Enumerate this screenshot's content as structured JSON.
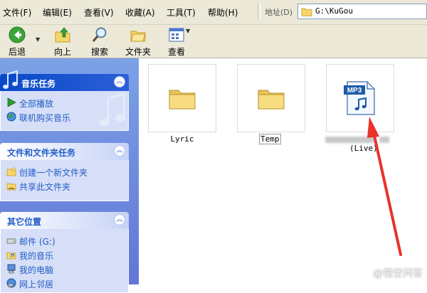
{
  "menubar": {
    "items": [
      "文件(F)",
      "编辑(E)",
      "查看(V)",
      "收藏(A)",
      "工具(T)",
      "帮助(H)"
    ],
    "address_label": "地址(D)",
    "address_value": "G:\\KuGou"
  },
  "toolbar": {
    "back": "后退",
    "up": "向上",
    "search": "搜索",
    "folders": "文件夹",
    "views": "查看"
  },
  "taskpane": {
    "music_tasks": {
      "title": "音乐任务",
      "items": [
        "全部播放",
        "联机购买音乐"
      ]
    },
    "file_tasks": {
      "title": "文件和文件夹任务",
      "items": [
        "创建一个新文件夹",
        "共享此文件夹"
      ]
    },
    "other_places": {
      "title": "其它位置",
      "items": [
        "邮件 (G:)",
        "我的音乐",
        "我的电脑",
        "网上邻居"
      ]
    }
  },
  "content": {
    "items": [
      {
        "name": "Lyric",
        "type": "folder"
      },
      {
        "name": "Temp",
        "type": "folder"
      },
      {
        "name_suffix": "(Live)",
        "type": "mp3",
        "badge": "MP3"
      }
    ]
  },
  "colors": {
    "arrow": "#e8322b",
    "link": "#215dc6",
    "pane_gradient_top": "#7ba2e7",
    "pane_gradient_bottom": "#6375d6"
  },
  "watermark": "@悟空问答"
}
